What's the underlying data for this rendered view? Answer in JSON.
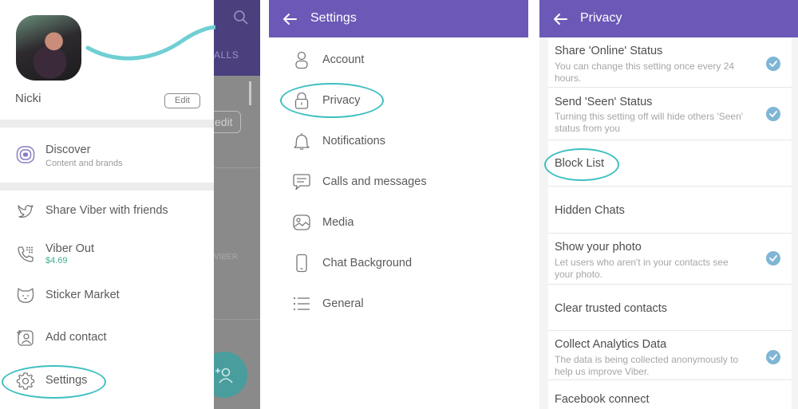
{
  "drawer": {
    "user_name": "Nicki",
    "edit_label": "Edit",
    "background_calls_tab": "ALLS",
    "background_edit": "edit",
    "background_list_label": "VIBER",
    "discover": {
      "label": "Discover",
      "sub": "Content and brands"
    },
    "items": [
      {
        "label": "Share Viber with friends",
        "icon": "twitter-bird-icon"
      },
      {
        "label": "Viber Out",
        "sub": "$4.69",
        "icon": "phone-dialpad-icon"
      },
      {
        "label": "Sticker Market",
        "icon": "cat-face-icon"
      },
      {
        "label": "Add contact",
        "icon": "add-contact-icon"
      },
      {
        "label": "Settings",
        "icon": "gear-icon"
      }
    ],
    "balance_color": "#3fae8f"
  },
  "settings": {
    "title": "Settings",
    "items": [
      {
        "label": "Account",
        "icon": "person-icon"
      },
      {
        "label": "Privacy",
        "icon": "lock-icon"
      },
      {
        "label": "Notifications",
        "icon": "bell-icon"
      },
      {
        "label": "Calls and messages",
        "icon": "chat-bubble-icon"
      },
      {
        "label": "Media",
        "icon": "image-icon"
      },
      {
        "label": "Chat Background",
        "icon": "phone-icon"
      },
      {
        "label": "General",
        "icon": "list-icon"
      }
    ]
  },
  "privacy": {
    "title": "Privacy",
    "items": [
      {
        "title": "Share 'Online' Status",
        "desc": "You can change this setting once every 24 hours.",
        "checked": true
      },
      {
        "title": "Send 'Seen' Status",
        "desc": "Turning this setting off will hide others 'Seen' status from you",
        "checked": true
      },
      {
        "title": "Block List"
      },
      {
        "title": "Hidden Chats"
      },
      {
        "title": "Show your photo",
        "desc": "Let users who aren't in your contacts see your photo.",
        "checked": true
      },
      {
        "title": "Clear trusted contacts"
      },
      {
        "title": "Collect Analytics Data",
        "desc": "The data is being collected anonymously to help us improve Viber.",
        "checked": true
      },
      {
        "title": "Facebook connect"
      }
    ]
  },
  "colors": {
    "accent_purple": "#6c58b6",
    "highlight_teal": "#3fbfc1",
    "check_blue": "#7fb6d5"
  }
}
